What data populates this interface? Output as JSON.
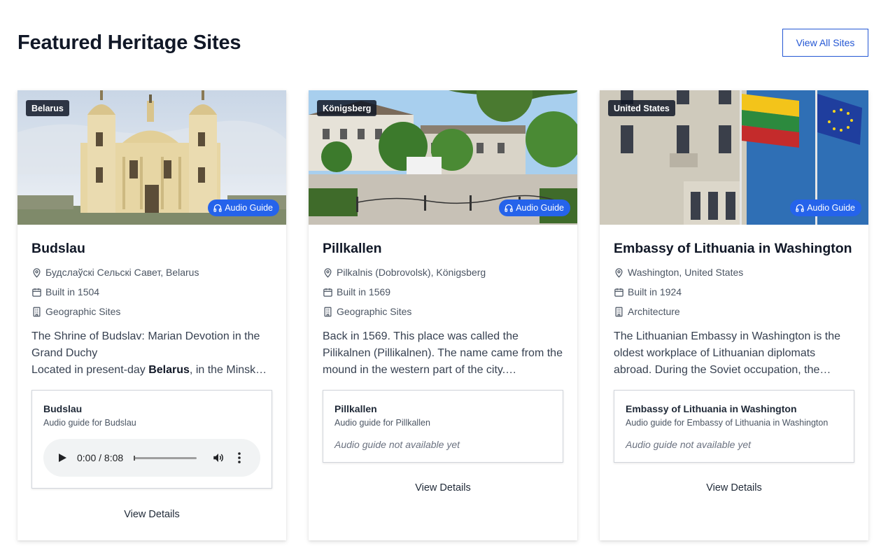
{
  "header": {
    "title": "Featured Heritage Sites",
    "view_all_label": "View All Sites"
  },
  "colors": {
    "accent": "#2563eb",
    "badge_dark": "#1f2937"
  },
  "cards": [
    {
      "country": "Belarus",
      "audio_badge": "Audio Guide",
      "title": "Budslau",
      "location": "Будслаўскі Сельскі Савет, Belarus",
      "built": "Built in 1504",
      "category": "Geographic Sites",
      "desc_line1": "The Shrine of Budslav: Marian Devotion in the Grand Duchy",
      "desc_line2_pre": "Located in present-day ",
      "desc_line2_bold": "Belarus",
      "desc_line2_post": ", in the Minsk…",
      "audio_title": "Budslau",
      "audio_sub": "Audio guide for Budslau",
      "player_time": "0:00 / 8:08",
      "view_details": "View Details"
    },
    {
      "country": "Königsberg",
      "audio_badge": "Audio Guide",
      "title": "Pillkallen",
      "location": "Pilkalnis (Dobrovolsk), Königsberg",
      "built": "Built in 1569",
      "category": "Geographic Sites",
      "desc": "Back in 1569. This place was called the Pilikalnen (Pillikalnen). The name came from the mound in the western part of the city.…",
      "audio_title": "Pillkallen",
      "audio_sub": "Audio guide for Pillkallen",
      "audio_na": "Audio guide not available yet",
      "view_details": "View Details"
    },
    {
      "country": "United States",
      "audio_badge": "Audio Guide",
      "title": "Embassy of Lithuania in Washington",
      "location": "Washington, United States",
      "built": "Built in 1924",
      "category": "Architecture",
      "desc": "The Lithuanian Embassy in Washington is the oldest workplace of Lithuanian diplomats abroad. During the Soviet occupation, the…",
      "audio_title": "Embassy of Lithuania in Washington",
      "audio_sub": "Audio guide for Embassy of Lithuania in Washington",
      "audio_na": "Audio guide not available yet",
      "view_details": "View Details"
    }
  ]
}
